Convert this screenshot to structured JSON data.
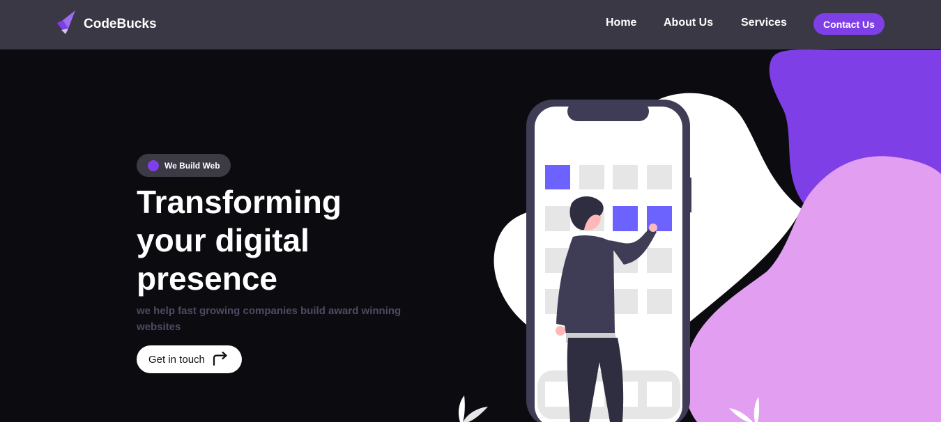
{
  "brand": {
    "name": "CodeBucks",
    "logo_icon": "logo-icon"
  },
  "nav": {
    "items": [
      {
        "label": "Home"
      },
      {
        "label": "About Us"
      },
      {
        "label": "Services"
      }
    ],
    "cta_label": "Contact Us"
  },
  "hero": {
    "tag": "We Build Web",
    "headline_lines": [
      "Transforming",
      "your digital",
      "presence"
    ],
    "subtitle": "we help fast growing companies build award winning websites",
    "cta_label": "Get in touch",
    "cta_icon": "arrow-turn-right-icon"
  },
  "colors": {
    "accent": "#7f3fe6",
    "navbar": "#393844",
    "background": "#0b0b10",
    "lilac": "#e29ef1",
    "tile_active": "#6c63ff"
  }
}
